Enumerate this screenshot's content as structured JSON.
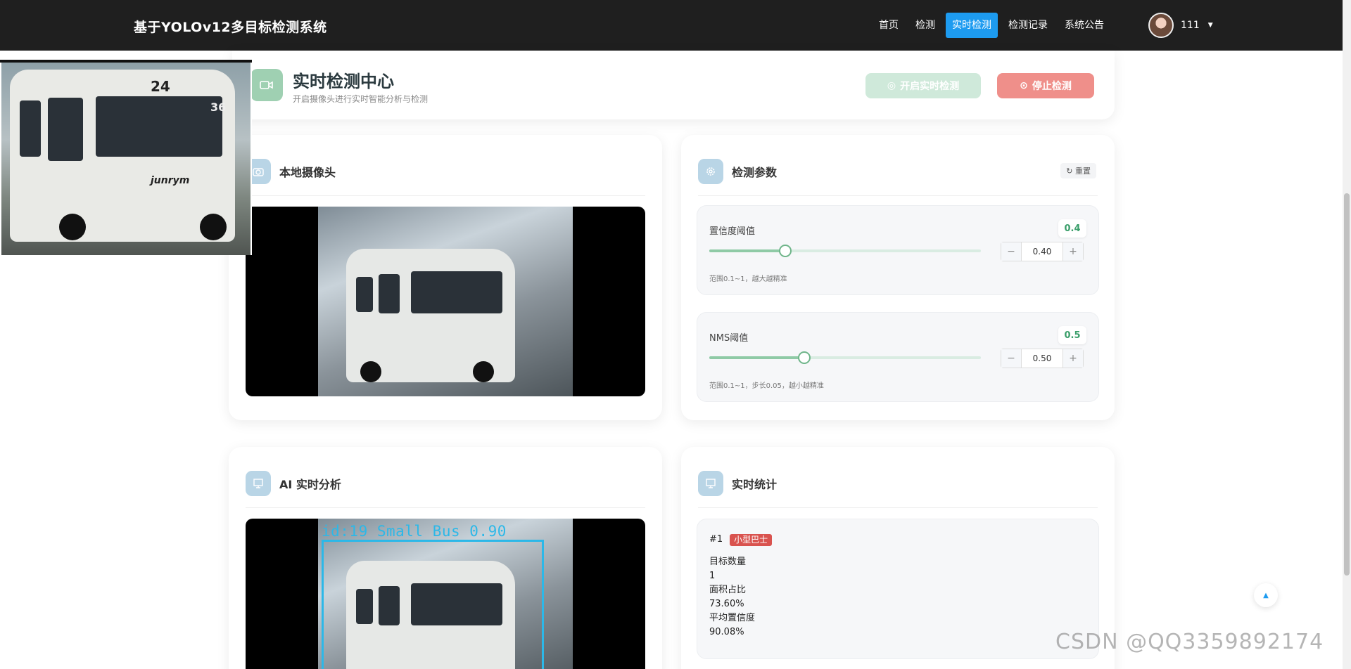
{
  "app": {
    "title": "基于YOLOv12多目标检测系统"
  },
  "nav": {
    "items": [
      "首页",
      "检测",
      "实时检测",
      "检测记录",
      "系统公告"
    ],
    "active_index": 2
  },
  "user": {
    "name": "111"
  },
  "header": {
    "title": "实时检测中心",
    "subtitle": "开启摄像头进行实时智能分析与检测",
    "start_label": "开启实时检测",
    "stop_label": "停止检测"
  },
  "camera": {
    "title": "本地摄像头"
  },
  "params": {
    "title": "检测参数",
    "reset_label": "重置",
    "confidence": {
      "label": "置信度阈值",
      "badge": "0.4",
      "value": "0.40",
      "fraction": 0.4,
      "hint": "范围0.1~1，越大越精准"
    },
    "nms": {
      "label": "NMS阈值",
      "badge": "0.5",
      "value": "0.50",
      "fraction": 0.5,
      "hint": "范围0.1~1，步长0.05，越小越精准"
    }
  },
  "analysis": {
    "title": "AI 实时分析",
    "detection_label": "id:19 Small Bus 0.90"
  },
  "stats": {
    "title": "实时统计",
    "index": "#1",
    "class_tag": "小型巴士",
    "count_label": "目标数量",
    "count_value": "1",
    "area_label": "面积占比",
    "area_value": "73.60%",
    "conf_label": "平均置信度",
    "conf_value": "90.08%"
  },
  "thumbnail": {
    "bus_number": "24",
    "bus_brand": "junrym",
    "plate": "36"
  },
  "watermark": "CSDN @QQ3359892174",
  "colors": {
    "nav_bg": "#1f1f1f",
    "nav_active": "#1d9bf0",
    "accent_green": "#8fcaa6",
    "stop_red": "#ef8f8a",
    "bbox_cyan": "#2cb8e8"
  }
}
